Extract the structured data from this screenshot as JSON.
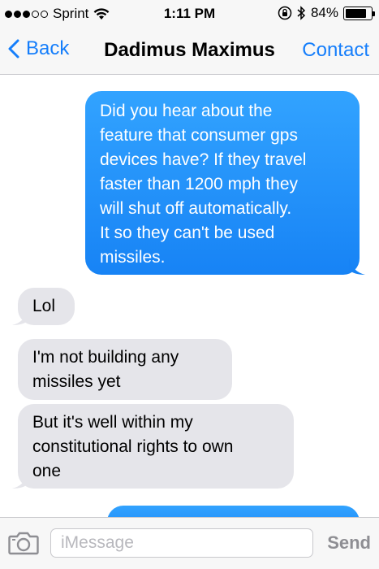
{
  "status_bar": {
    "carrier": "Sprint",
    "time": "1:11 PM",
    "battery_percent": "84%",
    "battery_level": 0.84,
    "signal_bars_filled": 3,
    "signal_bars_total": 5
  },
  "nav": {
    "back_label": "Back",
    "title": "Dadimus Maximus",
    "contact_label": "Contact"
  },
  "messages": [
    {
      "direction": "outgoing",
      "text": "Did you hear about the\nfeature that consumer gps\ndevices have? If they travel\nfaster than 1200 mph they\nwill shut off automatically.\nIt so they can't be used\nmissiles."
    },
    {
      "direction": "incoming",
      "text": "Lol"
    },
    {
      "direction": "incoming",
      "text": "I'm not building any\nmissiles yet"
    },
    {
      "direction": "incoming",
      "text": "But it's well within my\nconstitutional rights to own\none"
    }
  ],
  "input_bar": {
    "placeholder": "iMessage",
    "send_label": "Send"
  },
  "colors": {
    "accent": "#157efb",
    "outgoing_bubble": "#1b8cf7",
    "incoming_bubble": "#e5e5ea"
  }
}
